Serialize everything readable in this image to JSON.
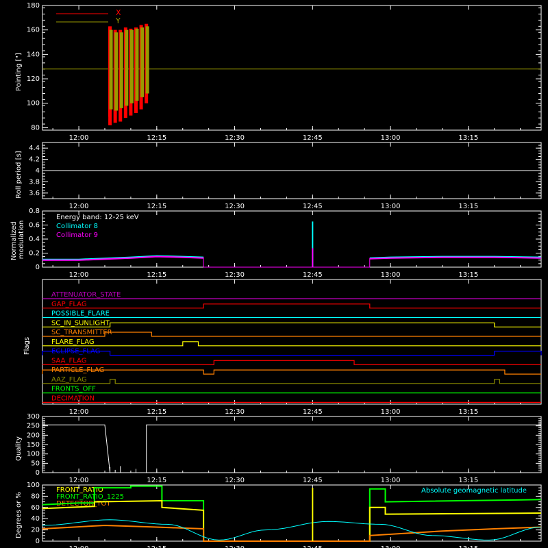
{
  "time_ticks": [
    "12:00",
    "12:15",
    "12:30",
    "12:45",
    "13:00",
    "13:15"
  ],
  "time_range": [
    "11:53",
    "13:29"
  ],
  "colors": {
    "bg": "#000000",
    "axis": "#ffffff",
    "red": "#ff0000",
    "olive": "#9a9a00",
    "cyan": "#00ffff",
    "magenta": "#ff00ff",
    "yellow": "#ffff00",
    "orange": "#ff8000",
    "green": "#00ff00",
    "blue": "#0000ff",
    "purple": "#c000c0",
    "olive_flag": "#8c8c00"
  },
  "chart_data": [
    {
      "type": "line",
      "id": "pointing",
      "ylabel": "Pointing [\"]",
      "ylim": [
        78,
        180
      ],
      "yticks": [
        80,
        100,
        120,
        140,
        160,
        180
      ],
      "legend": [
        {
          "name": "X",
          "color": "#ff0000"
        },
        {
          "name": "Y",
          "color": "#9a9a00"
        }
      ],
      "legend_position": "top-left",
      "series": [
        {
          "name": "X",
          "color": "#ff0000",
          "x": [
            "12:06",
            "12:06",
            "12:07",
            "12:08",
            "12:09",
            "12:10",
            "12:11",
            "12:12",
            "12:13"
          ],
          "y_low": [
            89,
            82,
            84,
            85,
            88,
            90,
            92,
            95,
            100
          ],
          "y_high": [
            162,
            163,
            160,
            160,
            162,
            161,
            162,
            164,
            165
          ]
        },
        {
          "name": "Y",
          "color": "#9a9a00",
          "x": [
            "12:06",
            "12:07",
            "12:08",
            "12:09",
            "12:10",
            "12:11",
            "12:12",
            "12:13"
          ],
          "y_low": [
            95,
            94,
            96,
            98,
            100,
            102,
            105,
            108
          ],
          "y_high": [
            160,
            158,
            158,
            160,
            160,
            161,
            162,
            163
          ]
        }
      ],
      "reference_line": {
        "y": 128,
        "color": "#9a9a00"
      }
    },
    {
      "type": "line",
      "id": "roll",
      "ylabel": "Roll period [s]",
      "ylim": [
        3.5,
        4.5
      ],
      "yticks": [
        3.6,
        3.8,
        4.0,
        4.2,
        4.4
      ],
      "series": [
        {
          "name": "",
          "x": [
            "11:53",
            "13:29"
          ],
          "y": [
            4.0,
            4.0
          ],
          "color": "#ffffff"
        }
      ]
    },
    {
      "type": "line",
      "id": "modulation",
      "ylabel": "Normalized modulation",
      "ylim": [
        0,
        0.8
      ],
      "yticks": [
        0.0,
        0.2,
        0.4,
        0.6,
        0.8
      ],
      "legend": [
        {
          "name": "Energy band: 12-25 keV",
          "color": "#ffffff"
        },
        {
          "name": "Collimator 8",
          "color": "#00ffff"
        },
        {
          "name": "Collimator 9",
          "color": "#ff00ff"
        }
      ],
      "segments": [
        {
          "x": [
            "11:53",
            "12:00",
            "12:10",
            "12:15",
            "12:20",
            "12:24"
          ],
          "y": [
            0.1,
            0.1,
            0.13,
            0.15,
            0.14,
            0.13
          ]
        },
        {
          "x": [
            "12:56",
            "13:00",
            "13:10",
            "13:20",
            "13:29"
          ],
          "y": [
            0.12,
            0.13,
            0.14,
            0.14,
            0.13
          ]
        }
      ],
      "spike": {
        "x": "12:45",
        "cyan": 0.65,
        "magenta": 0.27
      }
    },
    {
      "type": "line",
      "id": "quality",
      "ylabel": "Quality",
      "ylim": [
        0,
        300
      ],
      "yticks": [
        0,
        50,
        100,
        150,
        200,
        250,
        300
      ],
      "series": [
        {
          "name": "",
          "color": "#ffffff",
          "x": [
            "11:53",
            "12:05",
            "12:06",
            "12:13",
            "12:13",
            "13:29"
          ],
          "y": [
            255,
            255,
            0,
            0,
            255,
            255
          ]
        }
      ],
      "spikes": [
        {
          "x": "12:06",
          "y": 30
        },
        {
          "x": "12:07",
          "y": 15
        },
        {
          "x": "12:08",
          "y": 35
        },
        {
          "x": "12:11",
          "y": 20
        }
      ]
    },
    {
      "type": "line",
      "id": "ratios",
      "ylabel": "Degrees or %",
      "ylim": [
        0,
        100
      ],
      "yticks": [
        0,
        20,
        40,
        60,
        80,
        100
      ],
      "legend": [
        {
          "name": "FRONT_RATIO",
          "color": "#ffff00"
        },
        {
          "name": "FRONT_RATIO_1225",
          "color": "#00ff00"
        },
        {
          "name": "DETECTOR_TOT",
          "color": "#ff8000"
        }
      ],
      "annotation": {
        "text": "Absolute geomagnetic latitude",
        "color": "#00ffff"
      },
      "series": [
        {
          "name": "FRONT_RATIO_1225",
          "color": "#00ff00",
          "x": [
            "11:53",
            "12:00",
            "12:03",
            "12:03",
            "12:10",
            "12:10",
            "12:16",
            "12:16",
            "12:24",
            "12:24",
            "12:56",
            "12:56",
            "12:59",
            "12:59",
            "13:29"
          ],
          "y": [
            65,
            68,
            68,
            95,
            95,
            98,
            98,
            72,
            72,
            0,
            0,
            93,
            93,
            70,
            74
          ]
        },
        {
          "name": "FRONT_RATIO",
          "color": "#ffff00",
          "x": [
            "11:53",
            "12:03",
            "12:03",
            "12:16",
            "12:16",
            "12:24",
            "12:24",
            "12:56",
            "12:56",
            "12:59",
            "12:59",
            "13:29"
          ],
          "y": [
            58,
            62,
            70,
            72,
            60,
            55,
            0,
            0,
            60,
            60,
            48,
            50
          ]
        },
        {
          "name": "DETECTOR_TOT",
          "color": "#ff8000",
          "x": [
            "11:53",
            "12:05",
            "12:15",
            "12:24",
            "12:24",
            "12:56",
            "12:56",
            "13:10",
            "13:20",
            "13:29"
          ],
          "y": [
            22,
            28,
            25,
            22,
            0,
            0,
            10,
            18,
            22,
            25
          ]
        },
        {
          "name": "Absolute geomagnetic latitude",
          "color": "#00ffff",
          "x": [
            "11:53",
            "12:06",
            "12:17",
            "12:27",
            "12:36",
            "12:48",
            "12:58",
            "13:08",
            "13:19",
            "13:29"
          ],
          "y": [
            28,
            38,
            30,
            2,
            20,
            35,
            30,
            10,
            2,
            25
          ]
        }
      ],
      "spike": {
        "x": "12:45",
        "y": 95,
        "color": "#ffff00"
      }
    }
  ],
  "flags": {
    "ylabel": "Flags",
    "rows": [
      {
        "name": "ATTENUATOR_STATE",
        "color": "#c000c0",
        "high": []
      },
      {
        "name": "GAP_FLAG",
        "color": "#ff0000",
        "high": [
          [
            "12:24",
            "12:56"
          ]
        ]
      },
      {
        "name": "POSSIBLE_FLARE",
        "color": "#00ffff",
        "high": []
      },
      {
        "name": "SC_IN_SUNLIGHT",
        "color": "#ffff00",
        "high": [
          [
            "12:06",
            "13:20"
          ]
        ]
      },
      {
        "name": "SC_TRANSMITTER",
        "color": "#ff8000",
        "high": [
          [
            "12:05",
            "12:14"
          ]
        ]
      },
      {
        "name": "FLARE_FLAG",
        "color": "#ffff00",
        "high": [
          [
            "12:20",
            "12:23"
          ]
        ]
      },
      {
        "name": "ECLIPSE_FLAG",
        "color": "#0000ff",
        "high": [
          [
            "11:53",
            "12:06"
          ],
          [
            "13:20",
            "13:29"
          ]
        ]
      },
      {
        "name": "SAA_FLAG",
        "color": "#ff0000",
        "high": [
          [
            "12:26",
            "12:53"
          ]
        ]
      },
      {
        "name": "PARTICLE_FLAG",
        "color": "#ff8000",
        "high": [
          [
            "11:53",
            "12:24"
          ],
          [
            "12:26",
            "13:22"
          ]
        ]
      },
      {
        "name": "AAZ_FLAG",
        "color": "#8c8c00",
        "high": [
          [
            "12:06",
            "12:07"
          ],
          [
            "13:20",
            "13:21"
          ]
        ]
      },
      {
        "name": "FRONTS_OFF",
        "color": "#00ff00",
        "high": []
      },
      {
        "name": "DECIMATION",
        "color": "#ff0000",
        "high": []
      }
    ]
  }
}
